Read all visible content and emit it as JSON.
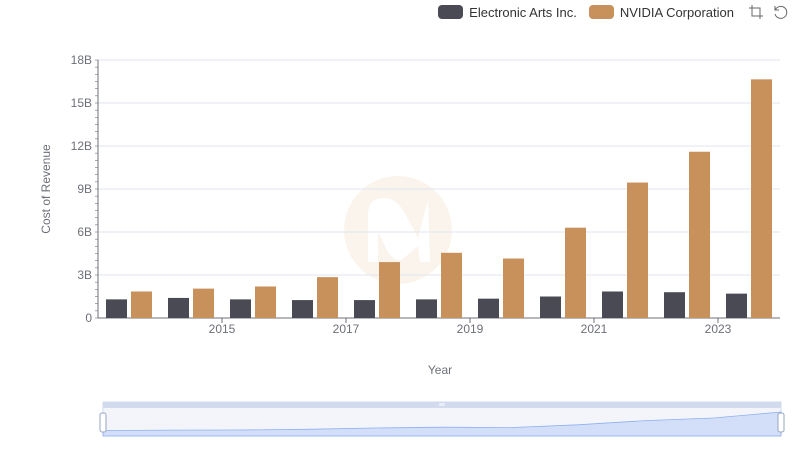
{
  "legend": {
    "items": [
      {
        "label": "Electronic Arts Inc.",
        "color": "#4a4a55"
      },
      {
        "label": "NVIDIA Corporation",
        "color": "#c8905a"
      }
    ]
  },
  "toolbox": {
    "icons": [
      "zoom-icon",
      "restore-icon"
    ]
  },
  "chart_data": {
    "type": "bar",
    "xlabel": "Year",
    "ylabel": "Cost of Revenue",
    "ylim": [
      0,
      18000000000
    ],
    "yticks": [
      "0",
      "3B",
      "6B",
      "9B",
      "12B",
      "15B",
      "18B"
    ],
    "xtick_labels": [
      "2015",
      "2017",
      "2019",
      "2021",
      "2023"
    ],
    "categories": [
      "2014",
      "2015",
      "2016",
      "2017",
      "2018",
      "2019",
      "2020",
      "2021",
      "2022",
      "2023",
      "2024"
    ],
    "series": [
      {
        "name": "Electronic Arts Inc.",
        "color": "#4a4a55",
        "values": [
          1300000000,
          1400000000,
          1300000000,
          1250000000,
          1250000000,
          1300000000,
          1350000000,
          1500000000,
          1850000000,
          1800000000,
          1700000000
        ]
      },
      {
        "name": "NVIDIA Corporation",
        "color": "#c8905a",
        "values": [
          1850000000,
          2050000000,
          2200000000,
          2850000000,
          3900000000,
          4550000000,
          4150000000,
          6300000000,
          9450000000,
          11600000000,
          16650000000
        ]
      }
    ],
    "grid": true,
    "legend_position": "top-right",
    "datazoom": {
      "range": [
        0,
        100
      ]
    }
  }
}
